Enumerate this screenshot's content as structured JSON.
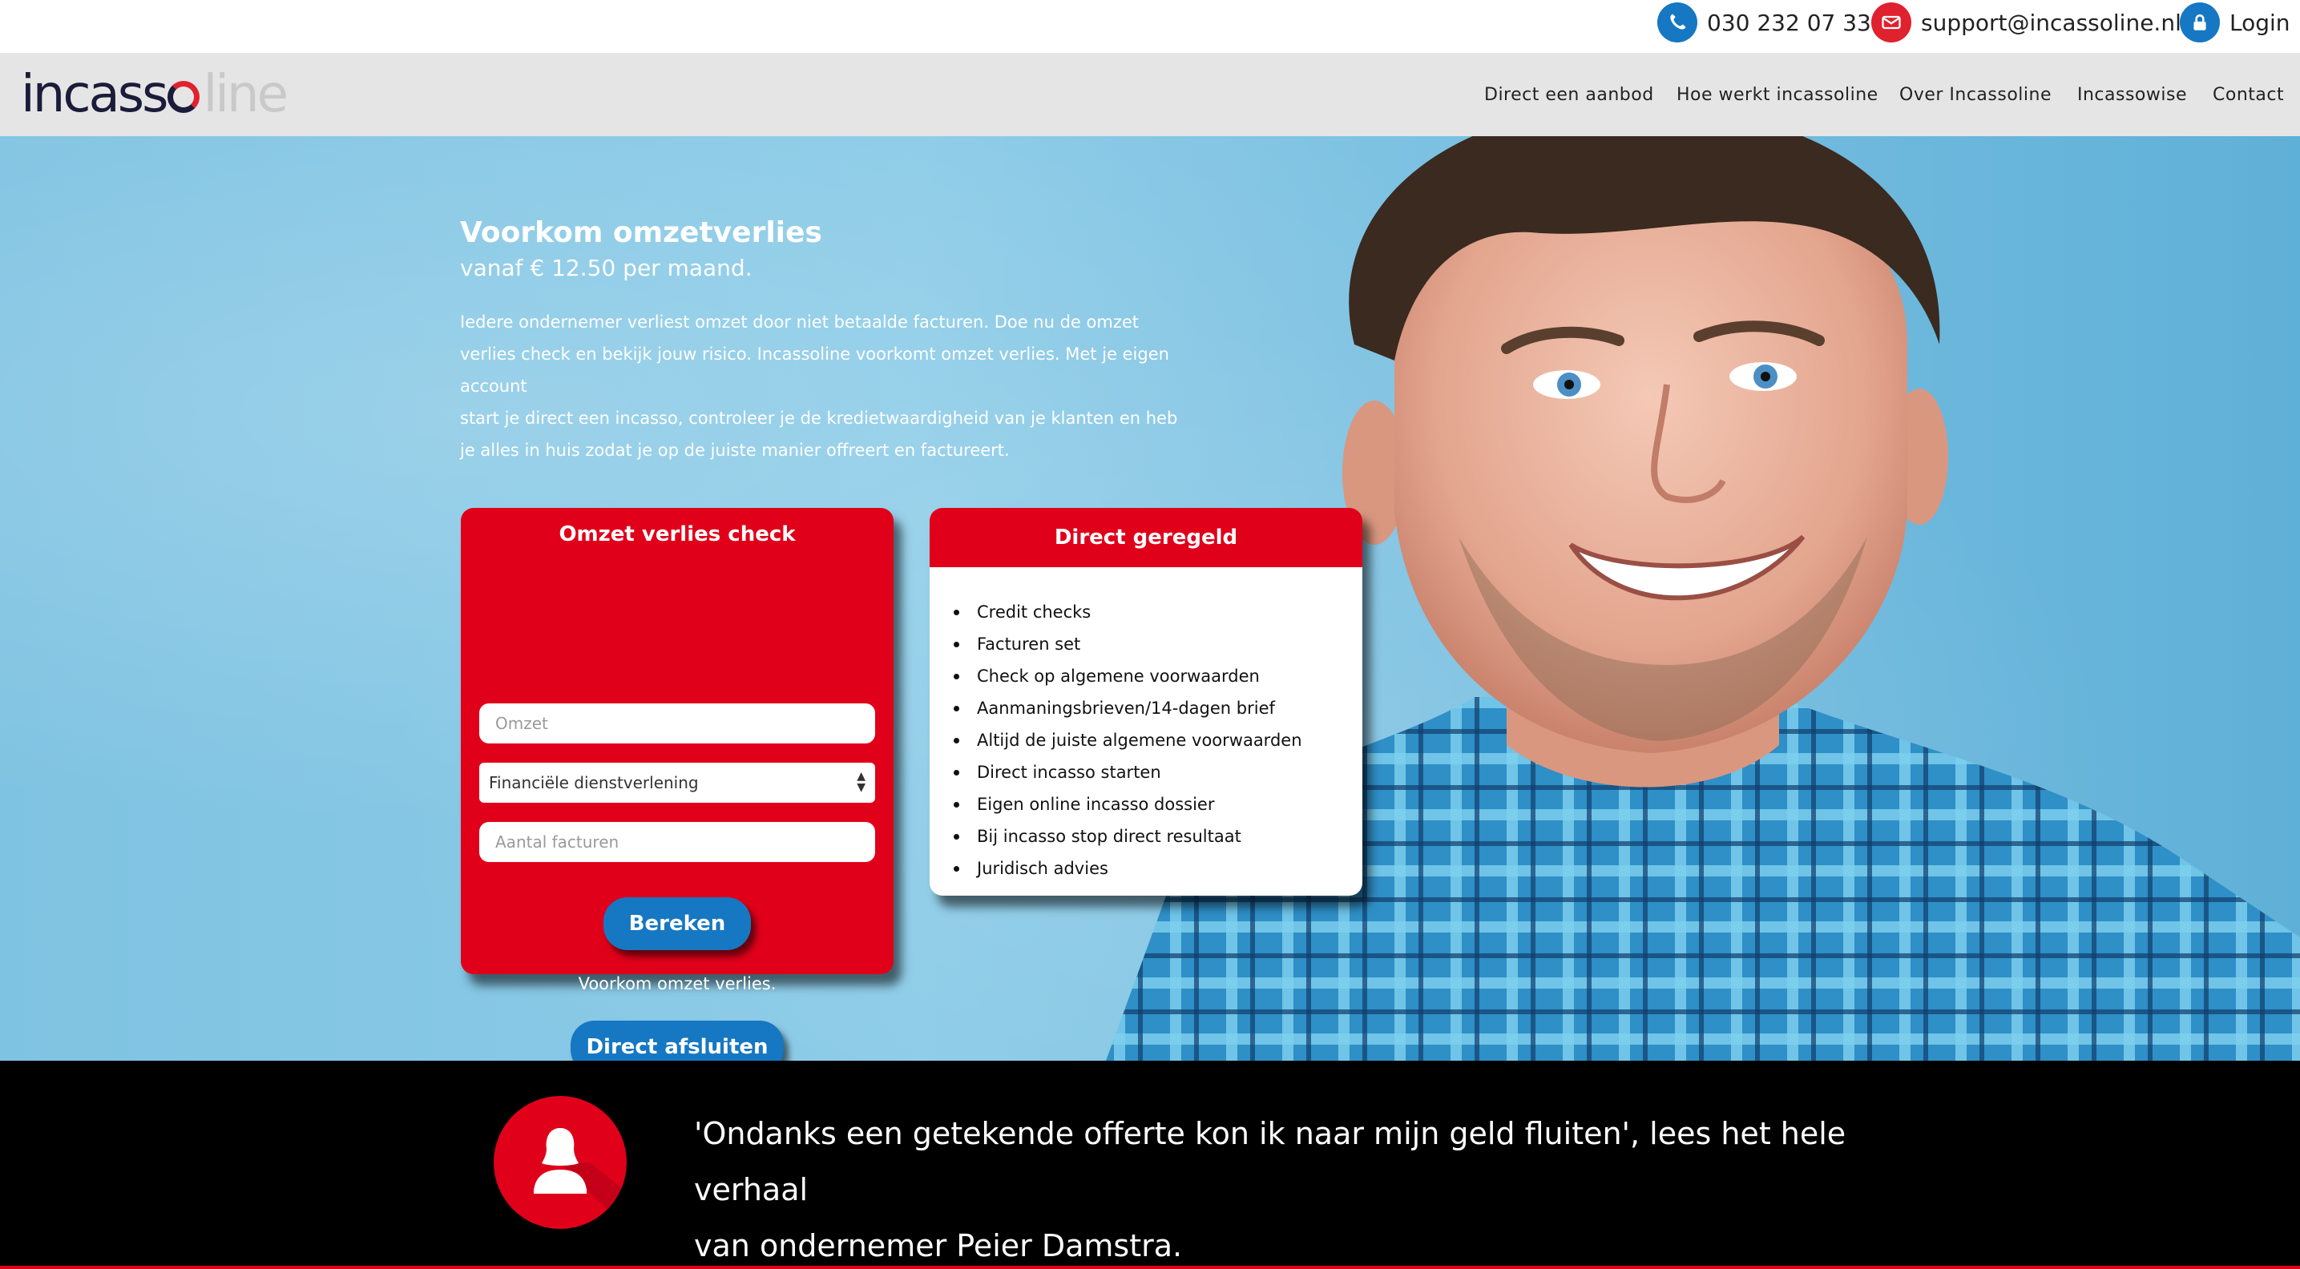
{
  "topbar": {
    "phone": "030 232 07 33",
    "email": "support@incassoline.nl",
    "login": "Login",
    "icons": {
      "phone": "phone-icon",
      "email": "mail-icon",
      "login": "lock-icon"
    },
    "colors": {
      "phone_icon": "#1677c2",
      "mail_icon": "#e0212e",
      "login_icon": "#1677c2"
    }
  },
  "logo": {
    "part1": "inc",
    "part2": "ass",
    "part3": "line"
  },
  "nav": {
    "items": [
      {
        "label": "Direct een aanbod"
      },
      {
        "label": "Hoe werkt incassoline"
      },
      {
        "label": "Over Incassoline"
      },
      {
        "label": "Incassowise"
      },
      {
        "label": "Contact"
      }
    ]
  },
  "hero": {
    "title": "Voorkom omzetverlies",
    "subtitle": "vanaf € 12.50 per maand.",
    "text": [
      "Iedere ondernemer verliest omzet door niet betaalde facturen. Doe nu de omzet",
      "verlies check en bekijk jouw risico. Incassoline voorkomt omzet verlies. Met je eigen account",
      "start je direct een incasso, controleer je de kredietwaardigheid van je klanten en heb",
      "je alles in huis zodat je op de juiste manier offreert en factureert."
    ]
  },
  "check_card": {
    "title": "Omzet verlies check",
    "omzet_placeholder": "Omzet",
    "sector_selected": "Financiële dienstverlening",
    "facturen_placeholder": "Aantal facturen",
    "calc_button": "Bereken",
    "note": "Voorkom omzet verlies.",
    "close_button": "Direct afsluiten",
    "colors": {
      "card": "#e0001a",
      "button": "#1677c2"
    }
  },
  "direct_card": {
    "title": "Direct geregeld",
    "items": [
      "Credit checks",
      "Facturen set",
      "Check op algemene voorwaarden",
      "Aanmaningsbrieven/14-dagen brief",
      "Altijd de juiste algemene voorwaarden",
      "Direct incasso starten",
      "Eigen online incasso dossier",
      "Bij incasso stop direct resultaat",
      "Juridisch advies"
    ]
  },
  "testimonial": {
    "line1": "'Ondanks een getekende offerte kon ik naar mijn geld fluiten', lees het hele verhaal",
    "line2": "van ondernemer Peier Damstra.",
    "icon": "user-silhouette-icon"
  }
}
